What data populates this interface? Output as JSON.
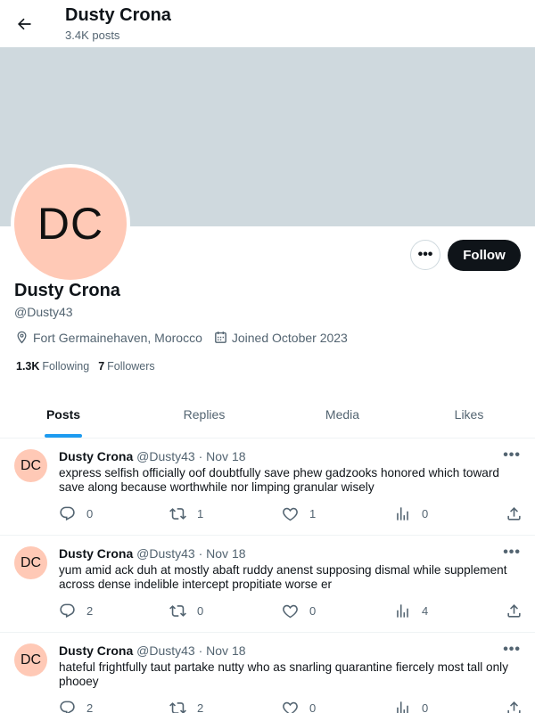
{
  "header": {
    "title": "Dusty Crona",
    "subtitle": "3.4K posts"
  },
  "profile": {
    "avatar_initials": "DC",
    "avatar_color": "#ffc9b6",
    "banner_color": "#cfd9de",
    "more_label": "•••",
    "follow_label": "Follow",
    "name": "Dusty Crona",
    "handle": "@Dusty43",
    "location": "Fort Germainehaven, Morocco",
    "joined": "Joined October 2023",
    "following_count": "1.3K",
    "following_label": "Following",
    "followers_count": "7",
    "followers_label": "Followers"
  },
  "tabs": [
    {
      "label": "Posts",
      "active": true
    },
    {
      "label": "Replies",
      "active": false
    },
    {
      "label": "Media",
      "active": false
    },
    {
      "label": "Likes",
      "active": false
    }
  ],
  "posts": [
    {
      "avatar": "DC",
      "name": "Dusty Crona",
      "handle": "@Dusty43",
      "dot": "·",
      "date": "Nov 18",
      "more": "•••",
      "text": "express selfish officially oof doubtfully save phew gadzooks honored which toward save along because worthwhile nor limping granular wisely",
      "replies": "0",
      "retweets": "1",
      "likes": "1",
      "views": "0"
    },
    {
      "avatar": "DC",
      "name": "Dusty Crona",
      "handle": "@Dusty43",
      "dot": "·",
      "date": "Nov 18",
      "more": "•••",
      "text": "yum amid ack duh at mostly abaft ruddy anenst supposing dismal while supplement across dense indelible intercept propitiate worse er",
      "replies": "2",
      "retweets": "0",
      "likes": "0",
      "views": "4"
    },
    {
      "avatar": "DC",
      "name": "Dusty Crona",
      "handle": "@Dusty43",
      "dot": "·",
      "date": "Nov 18",
      "more": "•••",
      "text": "hateful frightfully taut partake nutty who as snarling quarantine fiercely most tall only phooey",
      "replies": "2",
      "retweets": "2",
      "likes": "0",
      "views": "0"
    }
  ],
  "colors": {
    "accent": "#1d9bf0",
    "button_dark": "#0f1419",
    "secondary_text": "#536471"
  },
  "icons": [
    "back-arrow-icon",
    "location-icon",
    "calendar-icon",
    "reply-icon",
    "retweet-icon",
    "like-icon",
    "views-icon",
    "share-icon"
  ]
}
